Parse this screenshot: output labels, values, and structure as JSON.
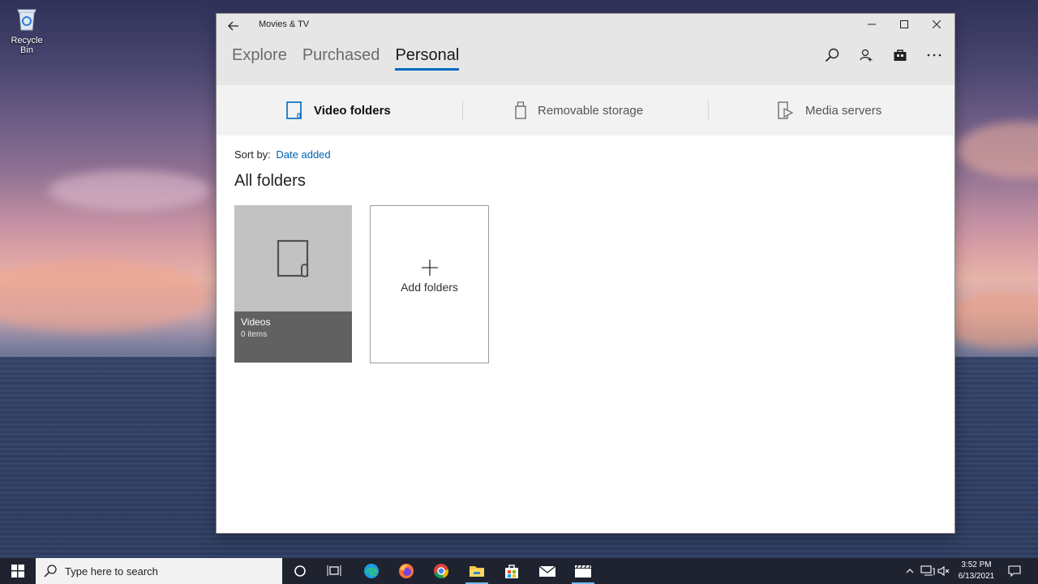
{
  "desktop": {
    "icons": [
      {
        "label": "Recycle Bin",
        "icon": "recycle-bin-icon"
      }
    ]
  },
  "window": {
    "title": "Movies & TV",
    "tabs": [
      {
        "label": "Explore",
        "active": false
      },
      {
        "label": "Purchased",
        "active": false
      },
      {
        "label": "Personal",
        "active": true
      }
    ],
    "toolbar_icons": [
      "search-icon",
      "account-icon",
      "store-icon",
      "more-icon"
    ],
    "subnav": [
      {
        "label": "Video folders",
        "icon": "video-folder-icon",
        "active": true
      },
      {
        "label": "Removable storage",
        "icon": "usb-drive-icon",
        "active": false
      },
      {
        "label": "Media servers",
        "icon": "media-server-icon",
        "active": false
      }
    ],
    "sort": {
      "label": "Sort by:",
      "value": "Date added"
    },
    "section_title": "All folders",
    "folders": [
      {
        "name": "Videos",
        "count": "0 items"
      }
    ],
    "add_folder_label": "Add folders",
    "accent_color": "#0067c0"
  },
  "taskbar": {
    "search_placeholder": "Type here to search",
    "pinned": [
      "cortana-icon",
      "task-view-icon",
      "edge-icon",
      "firefox-icon",
      "chrome-icon",
      "file-explorer-icon",
      "store-icon",
      "mail-icon",
      "movies-tv-icon"
    ],
    "clock": {
      "time": "3:52 PM",
      "date": "6/13/2021"
    }
  }
}
